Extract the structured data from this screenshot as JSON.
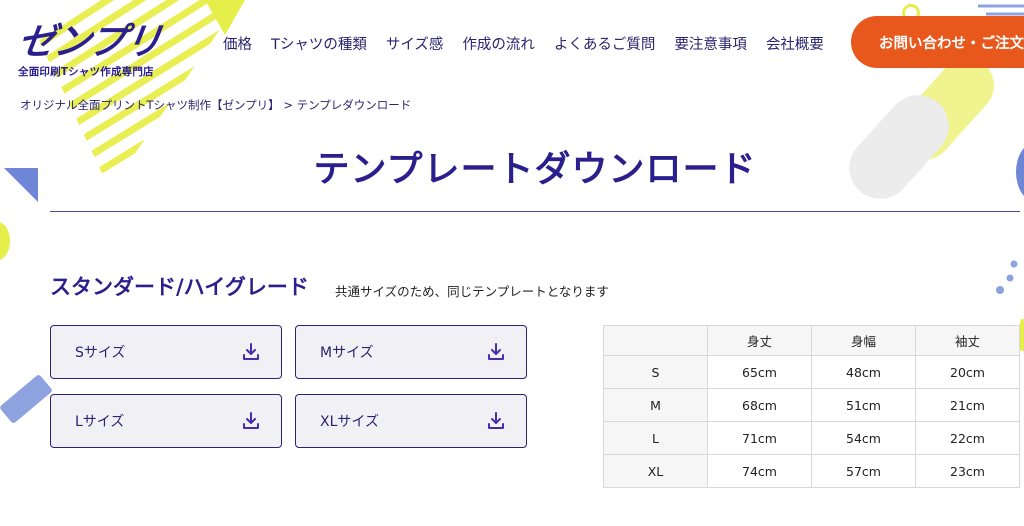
{
  "header": {
    "logo_text": "ゼンプリ",
    "logo_sub": "全面印刷Tシャツ作成専門店",
    "nav": [
      "価格",
      "Tシャツの種類",
      "サイズ感",
      "作成の流れ",
      "よくあるご質問",
      "要注意事項",
      "会社概要"
    ],
    "contact_label": "お問い合わせ・ご注文"
  },
  "breadcrumb": "オリジナル全面プリントTシャツ制作【ゼンプリ】 > テンプレダウンロード",
  "page_title": "テンプレートダウンロード",
  "section": {
    "heading": "スタンダード/ハイグレード",
    "note": "共通サイズのため、同じテンプレートとなります"
  },
  "downloads": [
    {
      "label": "Sサイズ"
    },
    {
      "label": "Mサイズ"
    },
    {
      "label": "Lサイズ"
    },
    {
      "label": "XLサイズ"
    }
  ],
  "size_table": {
    "headers": [
      "",
      "身丈",
      "身幅",
      "袖丈"
    ],
    "rows": [
      [
        "S",
        "65cm",
        "48cm",
        "20cm"
      ],
      [
        "M",
        "68cm",
        "51cm",
        "21cm"
      ],
      [
        "L",
        "71cm",
        "54cm",
        "22cm"
      ],
      [
        "XL",
        "74cm",
        "57cm",
        "23cm"
      ]
    ]
  },
  "colors": {
    "brand_navy": "#2a1f8c",
    "accent_orange": "#e8571c",
    "accent_yellow": "#e6ef4a",
    "accent_blue": "#6f86d6"
  },
  "icons": {
    "download": "download-icon"
  }
}
